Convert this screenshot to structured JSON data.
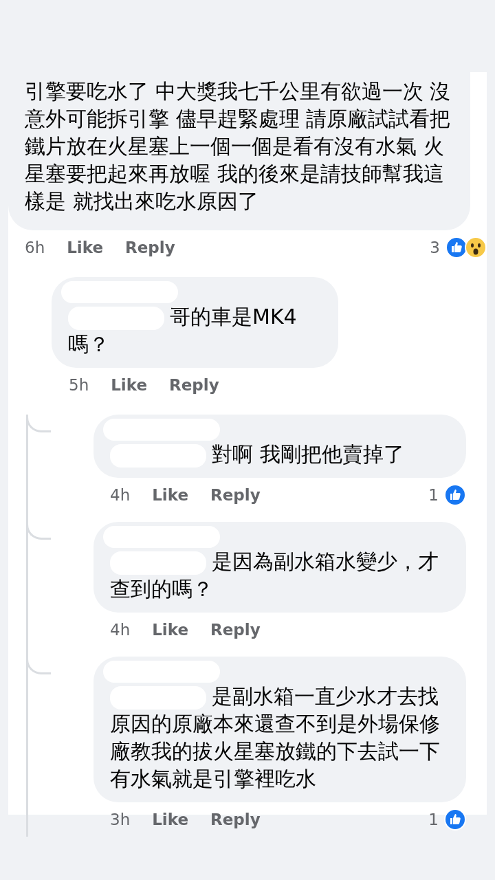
{
  "comment": {
    "text": "引擎要吃水了 中大獎我七千公里有欲過一次 沒意外可能拆引擎 儘早趕緊處理 請原廠試試看把鐵片放在火星塞上一個一個是看有沒有水氣 火星塞要把起來再放喔 我的後來是請技師幫我這樣是 就找出來吃水原因了",
    "time": "6h",
    "actions": [
      "Like",
      "Reply"
    ],
    "reaction_count": "3",
    "reactions": [
      {
        "kind": "like"
      },
      {
        "kind": "wow"
      }
    ],
    "replies": [
      {
        "text": "哥的車是MK4嗎？",
        "time": "5h",
        "actions": [
          "Like",
          "Reply"
        ],
        "name_redacted": true,
        "replies": [
          {
            "text": "對啊 我剛把他賣掉了",
            "time": "4h",
            "actions": [
              "Like",
              "Reply"
            ],
            "name_redacted": true,
            "reaction_count": "1",
            "reactions": [
              {
                "kind": "like"
              }
            ]
          },
          {
            "text": "是因為副水箱水變少，才查到的嗎？",
            "time": "4h",
            "actions": [
              "Like",
              "Reply"
            ],
            "name_redacted": true
          },
          {
            "text": "是副水箱一直少水才去找原因的原廠本來還查不到是外場保修廠教我的拔火星塞放鐵的下去試一下有水氣就是引擎裡吃水",
            "time": "3h",
            "actions": [
              "Like",
              "Reply"
            ],
            "name_redacted": true,
            "reaction_count": "1",
            "reactions": [
              {
                "kind": "like"
              }
            ]
          }
        ]
      }
    ]
  }
}
